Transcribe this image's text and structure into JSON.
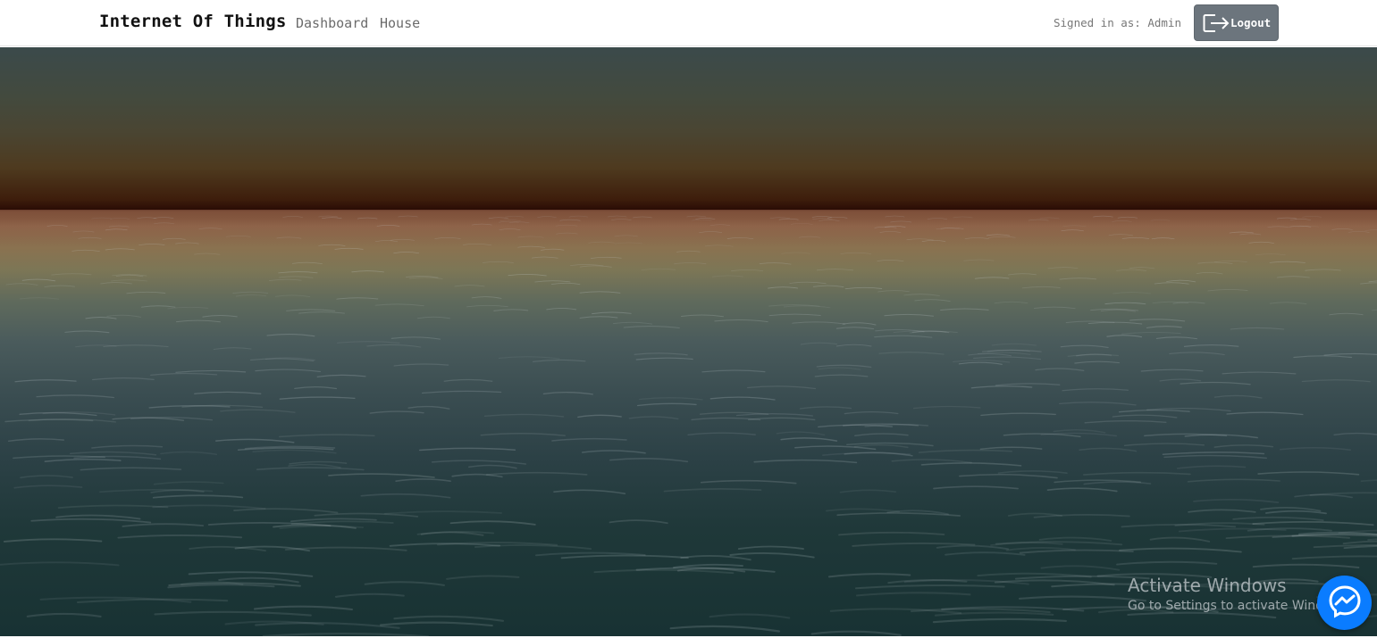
{
  "navbar": {
    "brand": "Internet Of Things",
    "links": [
      {
        "label": "Dashboard"
      },
      {
        "label": "House"
      }
    ],
    "signed_in_text": "Signed in as: Admin",
    "logout_label": "Logout",
    "logout_icon": "logout-icon"
  },
  "overlay": {
    "watermark_title": "Activate Windows",
    "watermark_subtitle": "Go to Settings to activate Windows.",
    "chat_icon": "messenger-icon"
  },
  "colors": {
    "logout_button": "#6c757d",
    "messenger_button": "#0a7cff"
  }
}
